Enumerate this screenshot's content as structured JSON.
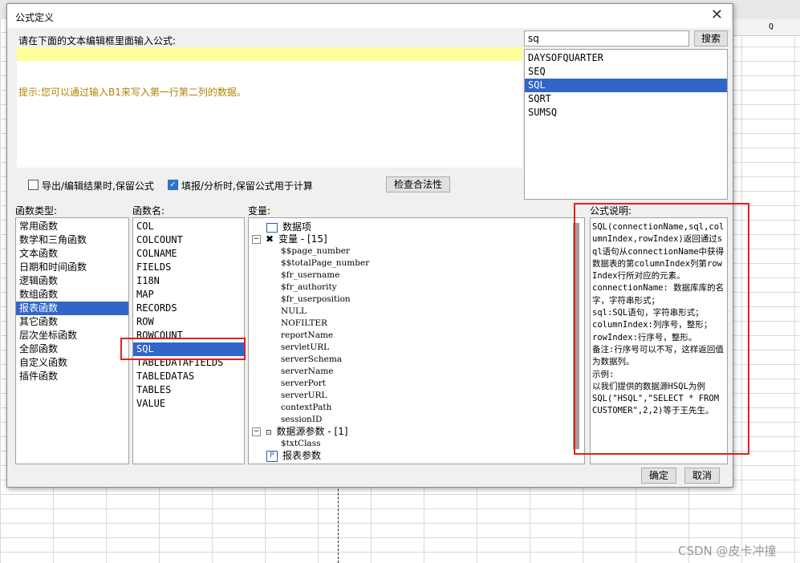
{
  "dialog": {
    "title": "公式定义",
    "close_glyph": "✕",
    "prompt_label": "请在下面的文本编辑框里面输入公式:",
    "hint": "提示:您可以通过输入B1来写入第一行第二列的数据。",
    "search_value": "sq",
    "search_button": "搜索",
    "search_results": [
      "DAYSOFQUARTER",
      "SEQ",
      "SQL",
      "SQRT",
      "SUMSQ"
    ],
    "selected_search_result": "SQL",
    "checkbox_keep_on_export": "导出/编辑结果时,保留公式",
    "checkbox_keep_on_fill": "填报/分析时,保留公式用于计算",
    "checkbox_keep_on_export_checked": false,
    "checkbox_keep_on_fill_checked": true,
    "check_button": "检查合法性",
    "func_type_label": "函数类型:",
    "func_name_label": "函数名:",
    "var_label": "变量:",
    "desc_label": "公式说明:",
    "func_types": [
      "常用函数",
      "数学和三角函数",
      "文本函数",
      "日期和时间函数",
      "逻辑函数",
      "数组函数",
      "报表函数",
      "其它函数",
      "层次坐标函数",
      "全部函数",
      "自定义函数",
      "插件函数"
    ],
    "selected_func_type": "报表函数",
    "func_names": [
      "COL",
      "COLCOUNT",
      "COLNAME",
      "FIELDS",
      "I18N",
      "MAP",
      "RECORDS",
      "ROW",
      "ROWCOUNT",
      "SQL",
      "TABLEDATAFIELDS",
      "TABLEDATAS",
      "TABLES",
      "VALUE"
    ],
    "selected_func_name": "SQL",
    "tree": {
      "data_items": "数据项",
      "variables_label": "变量 - [15]",
      "variables": [
        "$$page_number",
        "$$totalPage_number",
        "$fr_username",
        "$fr_authority",
        "$fr_userposition",
        "NULL",
        "NOFILTER",
        "reportName",
        "servletURL",
        "serverSchema",
        "serverName",
        "serverPort",
        "serverURL",
        "contextPath",
        "sessionID"
      ],
      "datasource_params_label": "数据源参数 - [1]",
      "datasource_params": [
        "$txtClass"
      ],
      "report_params": "报表参数"
    },
    "description": "SQL(connectionName,sql,columnIndex,rowIndex)返回通过sql语句从connectionName中获得数据表的第columnIndex列第rowIndex行所对应的元素。\nconnectionName: 数据库库的名字，字符串形式；\nsql:SQL语句，字符串形式；\ncolumnIndex:列序号，整形；\nrowIndex:行序号，整形。\n备注:行序号可以不写，这样返回值为数据列。\n示例:\n以我们提供的数据源HSQL为例\nSQL(\"HSQL\",\"SELECT * FROM CUSTOMER\",2,2)等于王先生。",
    "ok_button": "确定",
    "cancel_button": "取消"
  },
  "sheet": {
    "column_q": "Q"
  },
  "watermark": "CSDN @皮卡冲撞",
  "colors": {
    "selection": "#3166c8",
    "formula_bg": "#ffff99",
    "hint_text": "#b08000",
    "annotation_red": "#e02020"
  }
}
